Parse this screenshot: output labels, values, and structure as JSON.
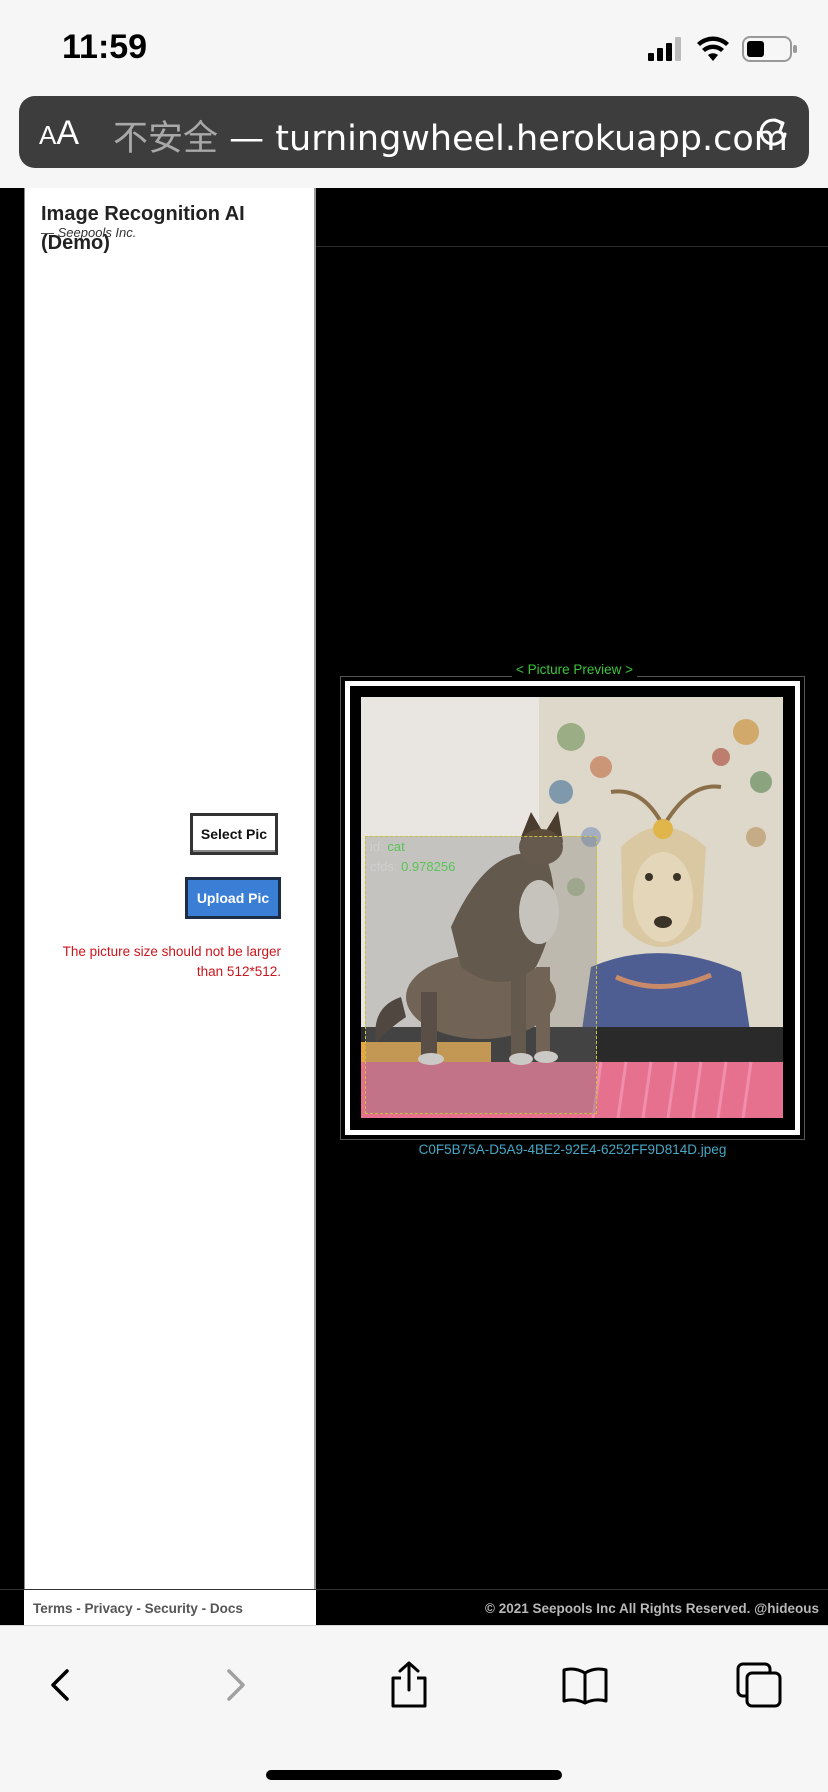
{
  "status_bar": {
    "time": "11:59"
  },
  "browser": {
    "aa_label_small": "A",
    "aa_label_large": "A",
    "security_label": "不安全",
    "separator": "—",
    "domain": "turningwheel.herokuapp.com"
  },
  "sidebar": {
    "title": "Image Recognition AI (Demo)",
    "subtitle": "— Seepools Inc.",
    "select_button": "Select Pic",
    "upload_button": "Upload Pic",
    "warning": "The picture size should not be larger than 512*512."
  },
  "preview": {
    "label": "< Picture Preview >",
    "detection": {
      "id_label": "id:",
      "id_value": "cat",
      "conf_label": "cfds:",
      "conf_value": "0.978256"
    },
    "filename": "C0F5B75A-D5A9-4BE2-92E4-6252FF9D814D.jpeg"
  },
  "footer": {
    "links": [
      "Terms",
      "Privacy",
      "Security",
      "Docs"
    ],
    "copyright": "© 2021 Seepools Inc All Rights Reserved. @hideous"
  },
  "colors": {
    "accent_blue": "#3a7fd5",
    "warning_red": "#c8161d",
    "preview_green": "#3bc43b",
    "filename_blue": "#47a7c4"
  }
}
